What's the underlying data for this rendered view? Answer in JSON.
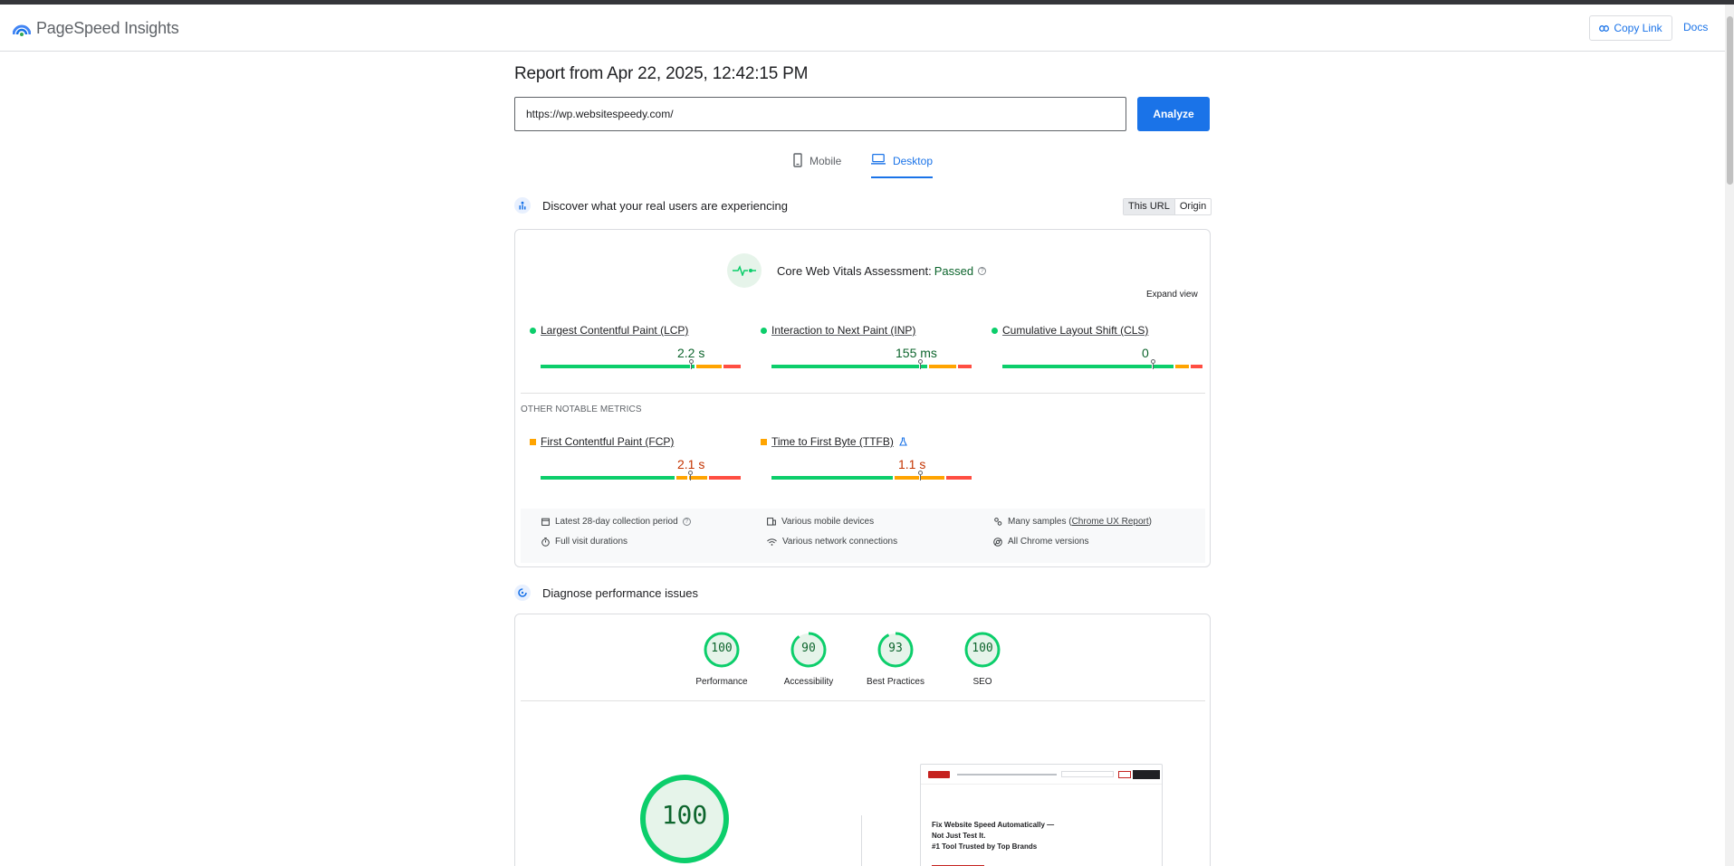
{
  "app": {
    "title": "PageSpeed Insights"
  },
  "header": {
    "copy_link": "Copy Link",
    "docs": "Docs"
  },
  "report": {
    "title": "Report from Apr 22, 2025, 12:42:15 PM",
    "url": "https://wp.websitespeedy.com/",
    "analyze_label": "Analyze"
  },
  "tabs": {
    "mobile": "Mobile",
    "desktop": "Desktop",
    "active": "desktop"
  },
  "field": {
    "section_title": "Discover what your real users are experiencing",
    "toggle": {
      "this_url": "This URL",
      "origin": "Origin"
    },
    "assessment_label": "Core Web Vitals Assessment:",
    "assessment_status": "Passed",
    "expand_view": "Expand view",
    "core_metrics": [
      {
        "name": "Largest Contentful Paint (LCP)",
        "value": "2.2 s",
        "rating": "good"
      },
      {
        "name": "Interaction to Next Paint (INP)",
        "value": "155 ms",
        "rating": "good"
      },
      {
        "name": "Cumulative Layout Shift (CLS)",
        "value": "0",
        "rating": "good"
      }
    ],
    "other_title": "OTHER NOTABLE METRICS",
    "other_metrics": [
      {
        "name": "First Contentful Paint (FCP)",
        "value": "2.1 s",
        "rating": "average"
      },
      {
        "name": "Time to First Byte (TTFB)",
        "value": "1.1 s",
        "rating": "average"
      }
    ],
    "info": {
      "collection_period": "Latest 28-day collection period",
      "devices": "Various mobile devices",
      "samples_prefix": "Many samples (",
      "samples_link": "Chrome UX Report",
      "samples_suffix": ")",
      "durations": "Full visit durations",
      "network": "Various network connections",
      "versions": "All Chrome versions"
    }
  },
  "lab": {
    "section_title": "Diagnose performance issues",
    "scores": [
      {
        "label": "Performance",
        "score": "100",
        "value": 100
      },
      {
        "label": "Accessibility",
        "score": "90",
        "value": 90
      },
      {
        "label": "Best Practices",
        "score": "93",
        "value": 93
      },
      {
        "label": "SEO",
        "score": "100",
        "value": 100
      }
    ],
    "big_score": "100",
    "screenshot_headline": [
      "Fix Website Speed Automatically —",
      "Not Just Test It.",
      "#1 Tool Trusted by Top Brands"
    ]
  },
  "colors": {
    "accent": "#1a73e8",
    "good": "#0cce6b",
    "average": "#ffa400",
    "poor": "#ff4e42"
  }
}
